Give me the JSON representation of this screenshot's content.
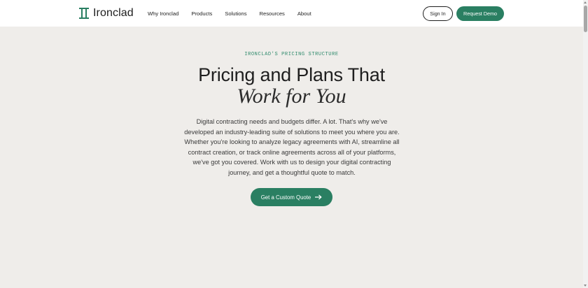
{
  "brand": {
    "name": "Ironclad",
    "accent": "#2a7f62"
  },
  "nav": {
    "items": [
      {
        "label": "Why Ironclad"
      },
      {
        "label": "Products"
      },
      {
        "label": "Solutions"
      },
      {
        "label": "Resources"
      },
      {
        "label": "About"
      }
    ],
    "sign_in_label": "Sign In",
    "request_demo_label": "Request Demo"
  },
  "hero": {
    "eyebrow": "IRONCLAD'S PRICING STRUCTURE",
    "headline": "Pricing and Plans That",
    "headline_italic": "Work for You",
    "body": "Digital contracting needs and budgets differ. A lot. That's why we've developed an industry-leading suite of solutions to meet you where you are. Whether you're looking to analyze legacy agreements with AI, streamline all contract creation, or track online agreements across all of your platforms, we've got you covered. Work with us to design your digital contracting journey, and get a thoughtful quote to match.",
    "cta_label": "Get a Custom Quote",
    "cta_icon": "arrow-right-icon"
  }
}
